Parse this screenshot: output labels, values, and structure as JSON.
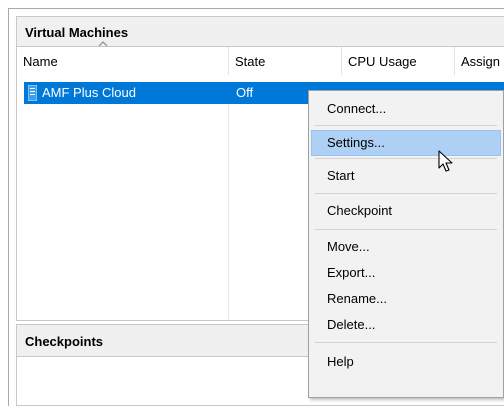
{
  "vm_panel": {
    "title": "Virtual Machines",
    "columns": [
      "Name",
      "State",
      "CPU Usage",
      "Assign"
    ],
    "rows": [
      {
        "name": "AMF Plus Cloud",
        "state": "Off"
      }
    ]
  },
  "checkpoints_panel": {
    "title": "Checkpoints"
  },
  "context_menu": {
    "items": [
      "Connect...",
      "Settings...",
      "Start",
      "Checkpoint",
      "Move...",
      "Export...",
      "Rename...",
      "Delete...",
      "Help"
    ],
    "highlighted": "Settings..."
  },
  "colors": {
    "selection": "#0078d7",
    "menu_highlight": "#aed0f5"
  },
  "icons": [
    "sort-ascending-icon",
    "vm-icon",
    "mouse-pointer-icon"
  ]
}
